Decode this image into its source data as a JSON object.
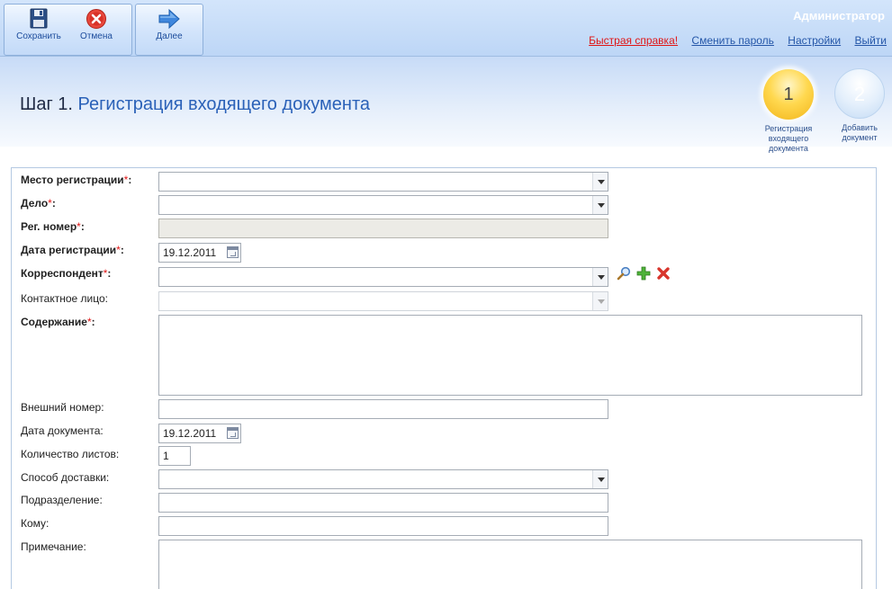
{
  "toolbar": {
    "save_label": "Сохранить",
    "cancel_label": "Отмена",
    "next_label": "Далее"
  },
  "user": {
    "name": "Администратор"
  },
  "links": {
    "help": "Быстрая справка!",
    "change_password": "Сменить пароль",
    "settings": "Настройки",
    "logout": "Выйти"
  },
  "header": {
    "step_prefix": "Шаг 1.",
    "step_title": "Регистрация входящего документа"
  },
  "wizard": {
    "steps": [
      {
        "number": "1",
        "caption": "Регистрация входящего документа",
        "active": true
      },
      {
        "number": "2",
        "caption": "Добавить документ",
        "active": false
      }
    ]
  },
  "form": {
    "required_mark": "*",
    "fields": {
      "registration_place": {
        "label": "Место регистрации",
        "value": ""
      },
      "case": {
        "label": "Дело",
        "value": ""
      },
      "reg_number": {
        "label": "Рег. номер",
        "value": ""
      },
      "reg_date": {
        "label": "Дата регистрации",
        "value": "19.12.2011"
      },
      "correspondent": {
        "label": "Корреспондент",
        "value": ""
      },
      "contact_person": {
        "label": "Контактное лицо:",
        "value": ""
      },
      "content": {
        "label": "Содержание",
        "value": ""
      },
      "external_number": {
        "label": "Внешний номер:",
        "value": ""
      },
      "document_date": {
        "label": "Дата документа:",
        "value": "19.12.2011"
      },
      "sheets_count": {
        "label": "Количество листов:",
        "value": "1"
      },
      "delivery_method": {
        "label": "Способ доставки:",
        "value": ""
      },
      "department": {
        "label": "Подразделение:",
        "value": ""
      },
      "recipient": {
        "label": "Кому:",
        "value": ""
      },
      "note": {
        "label": "Примечание:",
        "value": ""
      }
    }
  },
  "colors": {
    "accent": "#2a61b8",
    "required": "#e01515",
    "step_active": "#f2b51a"
  },
  "icons": {
    "save": "floppy-disk-icon",
    "cancel": "cancel-circle-icon",
    "next": "arrow-right-icon",
    "find": "magnifier-icon",
    "add": "plus-icon",
    "remove": "cross-icon"
  }
}
